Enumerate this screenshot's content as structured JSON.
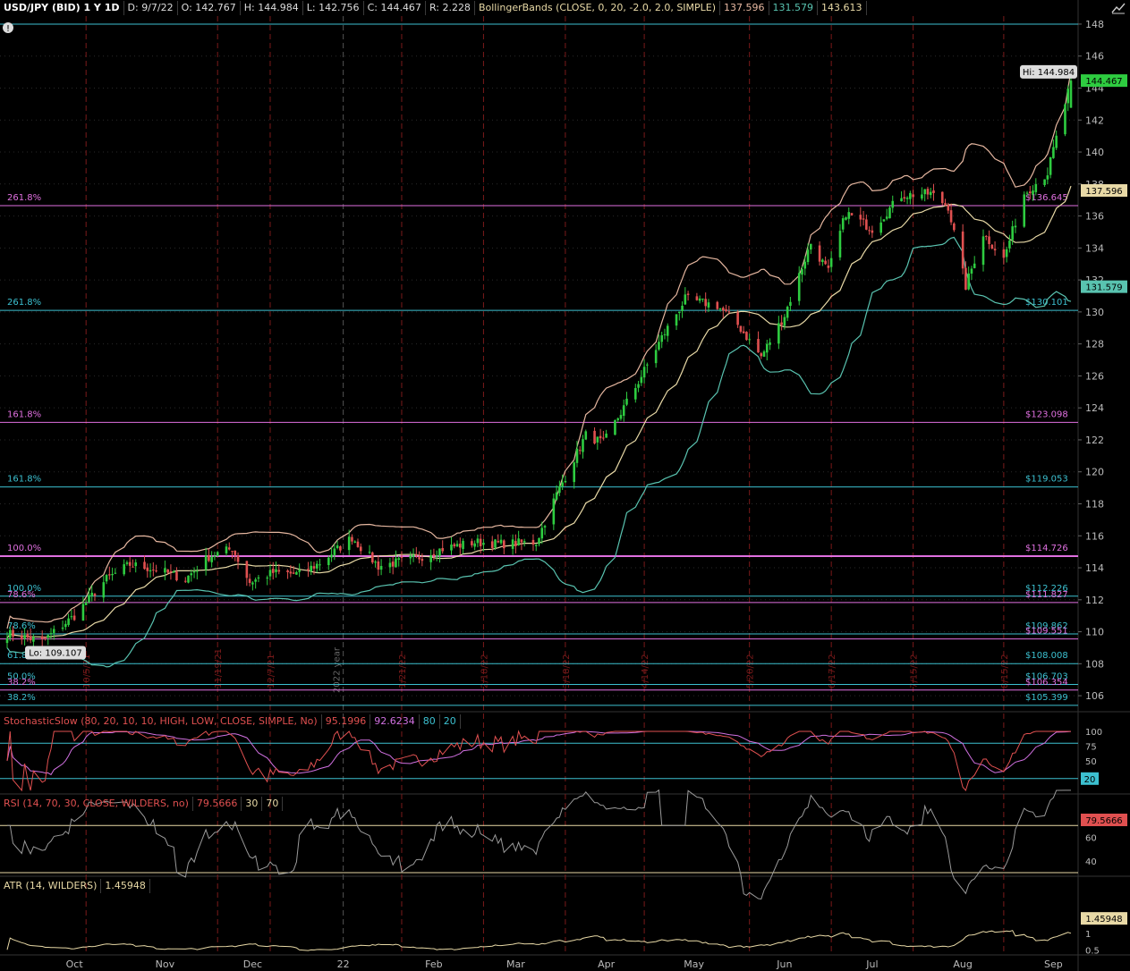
{
  "header": {
    "symbol": "USD/JPY (BID) 1 Y 1D",
    "date": "D: 9/7/22",
    "open": "O: 142.767",
    "high": "H: 144.984",
    "low": "L: 142.756",
    "close": "C: 144.467",
    "range": "R: 2.228",
    "study": "BollingerBands (CLOSE, 0, 20, -2.0, 2.0, SIMPLE)",
    "bb_upper": "137.596",
    "bb_mid": "131.579",
    "bb_lower": "143.613"
  },
  "colors": {
    "up": "#2ecc40",
    "down": "#e05050",
    "bb_upper": "#e6b7a0",
    "bb_mid": "#e8d9a6",
    "bb_lower": "#59c3b0",
    "fib_magenta": "#e070e0",
    "fib_cyan": "#3cc0d0"
  },
  "price_axis": {
    "ticks": [
      "148",
      "146",
      "144",
      "142",
      "140",
      "138",
      "136",
      "134",
      "132",
      "130",
      "128",
      "126",
      "124",
      "122",
      "120",
      "118",
      "116",
      "114",
      "112",
      "110",
      "108",
      "106"
    ]
  },
  "price_markers": {
    "hi": "Hi: 144.984",
    "lo": "Lo: 109.107",
    "last": "144.467",
    "bb_upper_tag": "137.596",
    "bb_lower_tag": "131.579"
  },
  "fib_levels": [
    {
      "pct": "261.8%",
      "price": "$136.645",
      "value": 136.645,
      "color": "magenta"
    },
    {
      "pct": "261.8%",
      "price": "$130.101",
      "value": 130.101,
      "color": "cyan"
    },
    {
      "pct": "161.8%",
      "price": "$123.098",
      "value": 123.098,
      "color": "magenta"
    },
    {
      "pct": "161.8%",
      "price": "$119.053",
      "value": 119.053,
      "color": "cyan"
    },
    {
      "pct": "100.0%",
      "price": "$114.726",
      "value": 114.726,
      "color": "magenta"
    },
    {
      "pct": "100.0%",
      "price": "$112.226",
      "value": 112.226,
      "color": "cyan"
    },
    {
      "pct": "78.6%",
      "price": "$111.827",
      "value": 111.827,
      "color": "magenta"
    },
    {
      "pct": "78.6%",
      "price": "$109.862",
      "value": 109.862,
      "color": "cyan"
    },
    {
      "pct": "",
      "price": "$109.551",
      "value": 109.551,
      "color": "magenta"
    },
    {
      "pct": "61.8%",
      "price": "$108.008",
      "value": 108.008,
      "color": "cyan"
    },
    {
      "pct": "50.0%",
      "price": "$106.703",
      "value": 106.703,
      "color": "cyan"
    },
    {
      "pct": "38.2%",
      "price": "$106.354",
      "value": 106.354,
      "color": "magenta"
    },
    {
      "pct": "38.2%",
      "price": "$105.399",
      "value": 105.399,
      "color": "cyan"
    }
  ],
  "date_markers": [
    "10/5/21",
    "11/19/21",
    "12/7/21",
    "1/21/22",
    "2/18/22",
    "3/18/22",
    "4/14/22",
    "5/20/22",
    "6/17/22",
    "7/15/22",
    "8/15/22"
  ],
  "year_marker": "2022 year",
  "x_axis": {
    "labels": [
      "Oct",
      "Nov",
      "Dec",
      "22",
      "Feb",
      "Mar",
      "Apr",
      "May",
      "Jun",
      "Jul",
      "Aug",
      "Sep"
    ]
  },
  "stoch": {
    "title": "StochasticSlow (80, 20, 10, 10, HIGH, LOW, CLOSE, SIMPLE, No)",
    "k": "95.1996",
    "d": "92.6234",
    "ob": "80",
    "os": "20",
    "ticks": [
      "100",
      "75",
      "50",
      "25"
    ],
    "tag": "20"
  },
  "rsi": {
    "title": "RSI (14, 70, 30, CLOSE, WILDERS, no)",
    "value": "79.5666",
    "lo": "30",
    "hi": "70",
    "ticks": [
      "60",
      "40"
    ],
    "tag": "79.5666"
  },
  "atr": {
    "title": "ATR (14, WILDERS)",
    "value": "1.45948",
    "ticks": [
      "1",
      "0.5"
    ],
    "tag": "1.45948"
  },
  "chart_data": {
    "type": "candlestick",
    "title": "USD/JPY (BID) 1 Y 1D",
    "ylim": [
      105,
      148.5
    ],
    "x_start": "2021-09-08",
    "x_end": "2022-09-07",
    "close_path": [
      [
        "2021-09-08",
        109.9
      ],
      [
        "2021-09-20",
        109.4
      ],
      [
        "2021-10-01",
        111.0
      ],
      [
        "2021-10-12",
        113.3
      ],
      [
        "2021-10-20",
        114.2
      ],
      [
        "2021-10-29",
        113.9
      ],
      [
        "2021-11-08",
        113.3
      ],
      [
        "2021-11-16",
        114.7
      ],
      [
        "2021-11-24",
        115.2
      ],
      [
        "2021-11-30",
        113.1
      ],
      [
        "2021-12-08",
        113.7
      ],
      [
        "2021-12-17",
        113.6
      ],
      [
        "2021-12-24",
        114.3
      ],
      [
        "2022-01-04",
        115.9
      ],
      [
        "2022-01-13",
        114.1
      ],
      [
        "2022-01-26",
        114.6
      ],
      [
        "2022-02-04",
        115.2
      ],
      [
        "2022-02-15",
        115.6
      ],
      [
        "2022-02-24",
        115.5
      ],
      [
        "2022-03-08",
        115.6
      ],
      [
        "2022-03-15",
        118.6
      ],
      [
        "2022-03-25",
        122.3
      ],
      [
        "2022-03-31",
        121.8
      ],
      [
        "2022-04-11",
        125.3
      ],
      [
        "2022-04-20",
        128.4
      ],
      [
        "2022-04-28",
        130.8
      ],
      [
        "2022-05-09",
        130.4
      ],
      [
        "2022-05-16",
        129.2
      ],
      [
        "2022-05-24",
        127.2
      ],
      [
        "2022-06-01",
        129.8
      ],
      [
        "2022-06-10",
        134.3
      ],
      [
        "2022-06-16",
        132.5
      ],
      [
        "2022-06-22",
        136.2
      ],
      [
        "2022-07-01",
        135.2
      ],
      [
        "2022-07-11",
        137.3
      ],
      [
        "2022-07-21",
        137.4
      ],
      [
        "2022-07-27",
        136.6
      ],
      [
        "2022-08-02",
        131.6
      ],
      [
        "2022-08-08",
        134.9
      ],
      [
        "2022-08-15",
        133.3
      ],
      [
        "2022-08-22",
        137.4
      ],
      [
        "2022-08-30",
        138.7
      ],
      [
        "2022-09-07",
        144.467
      ]
    ],
    "hi": 144.984,
    "lo": 109.107
  }
}
